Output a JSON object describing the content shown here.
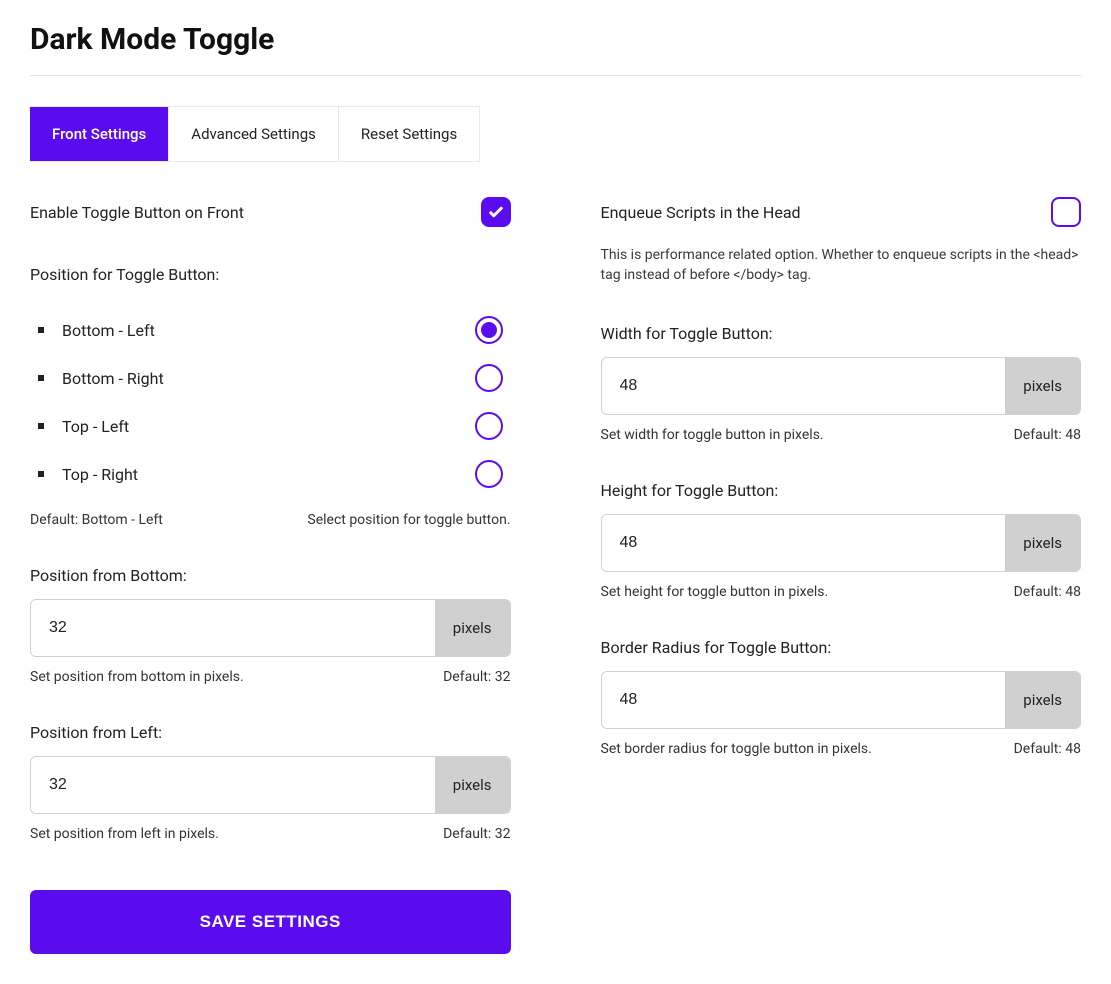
{
  "title": "Dark Mode Toggle",
  "tabs": [
    {
      "label": "Front Settings",
      "active": true
    },
    {
      "label": "Advanced Settings",
      "active": false
    },
    {
      "label": "Reset Settings",
      "active": false
    }
  ],
  "left": {
    "enable_label": "Enable Toggle Button on Front",
    "enable_checked": true,
    "position_label": "Position for Toggle Button:",
    "options": [
      {
        "label": "Bottom - Left",
        "selected": true
      },
      {
        "label": "Bottom - Right",
        "selected": false
      },
      {
        "label": "Top - Left",
        "selected": false
      },
      {
        "label": "Top - Right",
        "selected": false
      }
    ],
    "position_default": "Default: Bottom - Left",
    "position_hint": "Select position for toggle button.",
    "pos_bottom": {
      "label": "Position from Bottom:",
      "value": "32",
      "unit": "pixels",
      "hint": "Set position from bottom in pixels.",
      "default": "Default: 32"
    },
    "pos_left": {
      "label": "Position from Left:",
      "value": "32",
      "unit": "pixels",
      "hint": "Set position from left in pixels.",
      "default": "Default: 32"
    },
    "save": "SAVE SETTINGS"
  },
  "right": {
    "enqueue_label": "Enqueue Scripts in the Head",
    "enqueue_checked": false,
    "enqueue_hint": "This is performance related option. Whether to enqueue scripts in the <head> tag instead of before </body> tag.",
    "width": {
      "label": "Width for Toggle Button:",
      "value": "48",
      "unit": "pixels",
      "hint": "Set width for toggle button in pixels.",
      "default": "Default: 48"
    },
    "height": {
      "label": "Height for Toggle Button:",
      "value": "48",
      "unit": "pixels",
      "hint": "Set height for toggle button in pixels.",
      "default": "Default: 48"
    },
    "radius": {
      "label": "Border Radius for Toggle Button:",
      "value": "48",
      "unit": "pixels",
      "hint": "Set border radius for toggle button in pixels.",
      "default": "Default: 48"
    }
  }
}
